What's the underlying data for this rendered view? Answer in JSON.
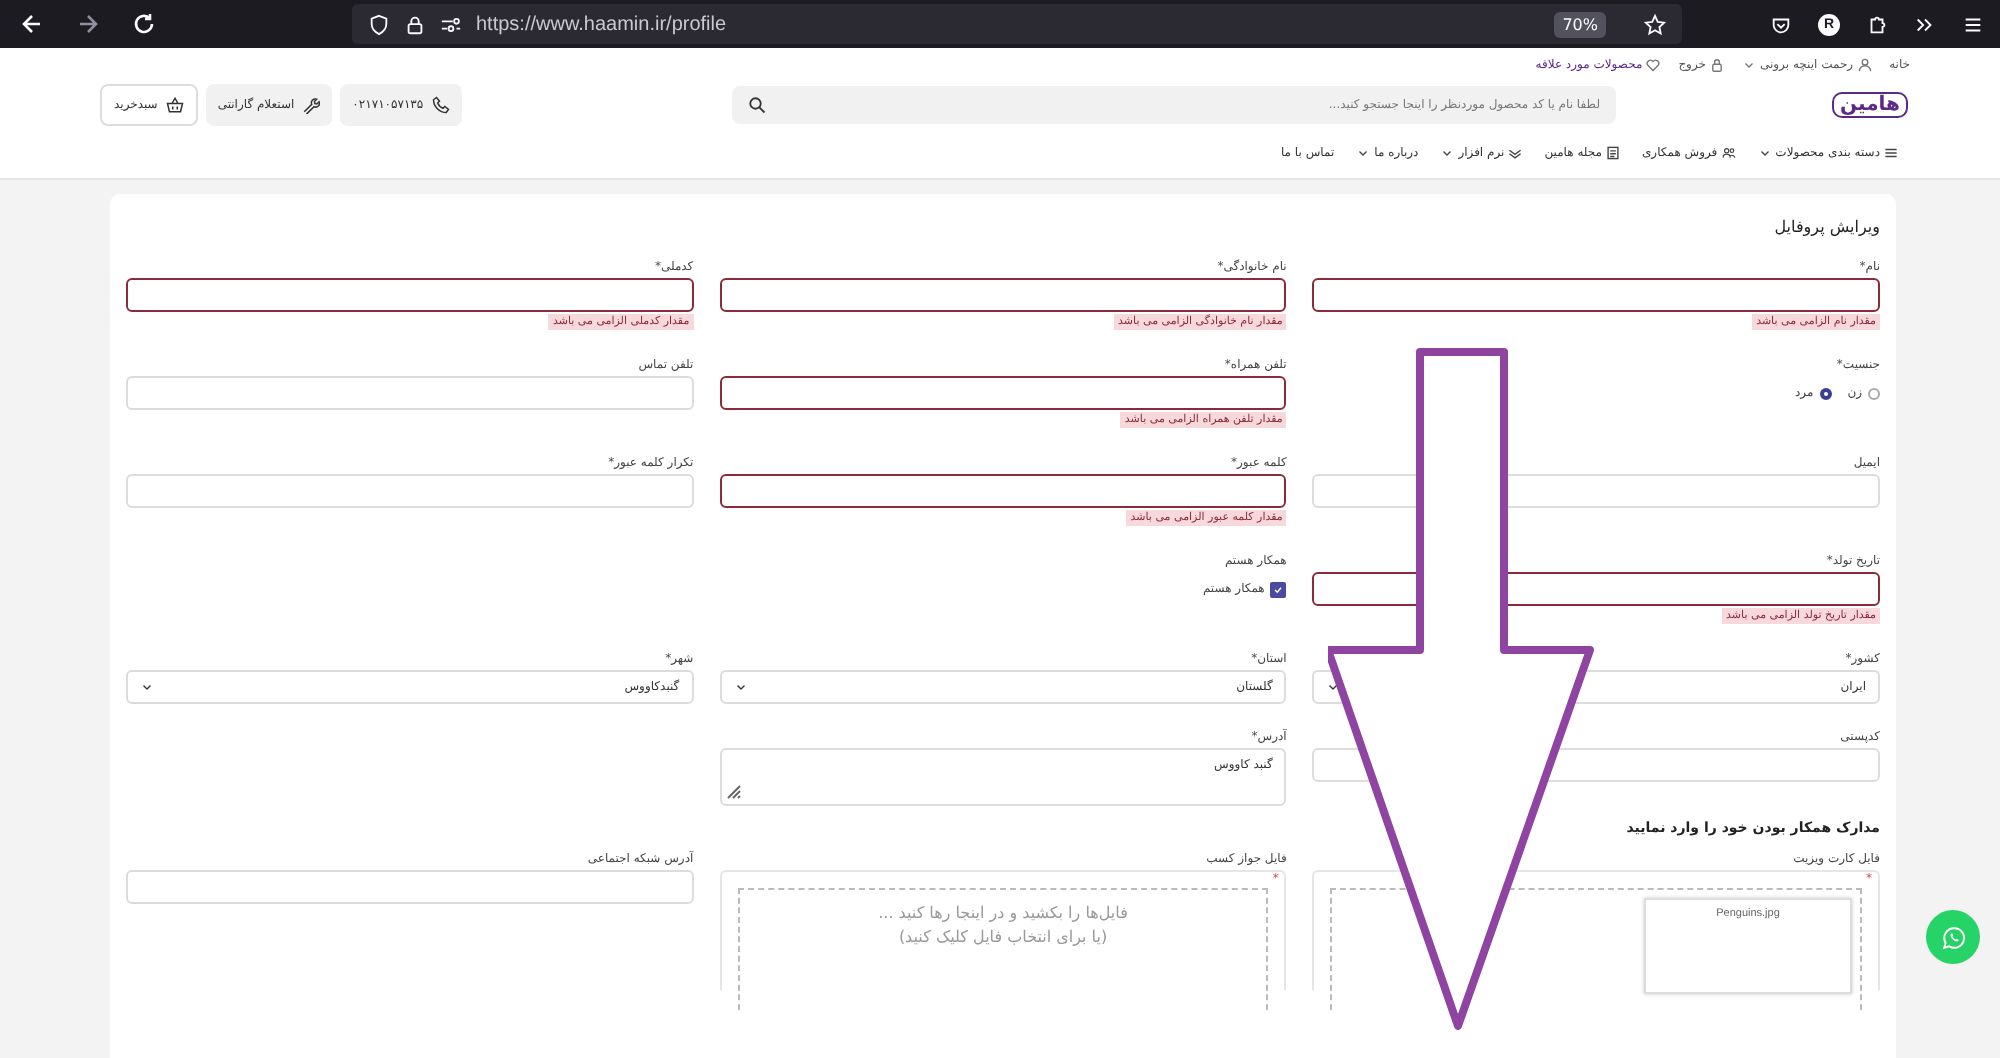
{
  "browser": {
    "url": "https://www.haamin.ir/profile",
    "zoom": "70%",
    "profile_initial": "R"
  },
  "header": {
    "top_links": [
      {
        "label": "خانه"
      },
      {
        "label": "رحمت اینچه برونی"
      },
      {
        "label": "خروج"
      },
      {
        "label": "محصولات مورد علاقه"
      }
    ],
    "logo": "هامین",
    "search": {
      "placeholder": "لطفا نام یا کد محصول موردنظر را اینجا جستجو کنید..."
    },
    "phone": "۰۲۱۷۱۰۵۷۱۳۵",
    "warranty": "استعلام گارانتی",
    "cart": "سبدخرید",
    "nav": [
      {
        "label": "دسته بندی محصولات",
        "dropdown": true
      },
      {
        "label": "فروش همکاری",
        "dropdown": false
      },
      {
        "label": "مجله هامین",
        "dropdown": false
      },
      {
        "label": "نرم افزار",
        "dropdown": true
      },
      {
        "label": "درباره ما",
        "dropdown": true
      },
      {
        "label": "تماس با ما",
        "dropdown": false
      }
    ]
  },
  "form": {
    "title": "ویرایش پروفایل",
    "rows": [
      [
        {
          "kind": "input",
          "label": "نام*",
          "error": "مقدار نام الزامی می باشد"
        },
        {
          "kind": "input",
          "label": "نام خانوادگی*",
          "error": "مقدار نام خانوادگی الزامی می باشد"
        },
        {
          "kind": "input",
          "label": "کدملی*",
          "error": "مقدار کدملی الزامی می باشد"
        }
      ],
      [
        {
          "kind": "radio",
          "label": "جنسیت*",
          "options": [
            {
              "label": "زن",
              "selected": false
            },
            {
              "label": "مرد",
              "selected": true
            }
          ]
        },
        {
          "kind": "input",
          "label": "تلفن همراه*",
          "error": "مقدار تلفن همراه الزامی می باشد"
        },
        {
          "kind": "input",
          "label": "تلفن تماس"
        }
      ],
      [
        {
          "kind": "input",
          "label": "ایمیل"
        },
        {
          "kind": "input",
          "label": "کلمه عبور*",
          "error": "مقدار کلمه عبور الزامی می باشد"
        },
        {
          "kind": "input",
          "label": "تکرار کلمه عبور*"
        }
      ],
      [
        {
          "kind": "input",
          "label": "تاریخ تولد*",
          "error": "مقدار تاریخ تولد الزامی می باشد"
        },
        {
          "kind": "checkbox",
          "label": "همکار هستم",
          "option": "همکار هستم",
          "checked": true
        },
        {
          "kind": "empty"
        }
      ],
      [
        {
          "kind": "select",
          "label": "کشور*",
          "value": "ایران"
        },
        {
          "kind": "select",
          "label": "استان*",
          "value": "گلستان"
        },
        {
          "kind": "select",
          "label": "شهر*",
          "value": "گنبدکاووس"
        }
      ],
      [
        {
          "kind": "input",
          "label": "کدپستی"
        },
        {
          "kind": "textarea",
          "label": "آدرس*",
          "value": "گنبد کاووس"
        },
        {
          "kind": "empty"
        }
      ]
    ],
    "docs_heading": "مدارک همکار بودن خود را وارد نمایید",
    "uploads": [
      {
        "kind": "file",
        "label": "فایل کارت ویزیت",
        "required_mark": "*",
        "file_name": "Penguins.jpg"
      },
      {
        "kind": "dropzone",
        "label": "فایل جواز کسب",
        "required_mark": "*",
        "hint": [
          "فایل‌ها را بکشید و در اینجا رها کنید ...",
          "(یا برای انتخاب فایل کلیک کنید)"
        ]
      },
      {
        "kind": "input",
        "label": "آدرس شبکه اجتماعی"
      }
    ]
  }
}
